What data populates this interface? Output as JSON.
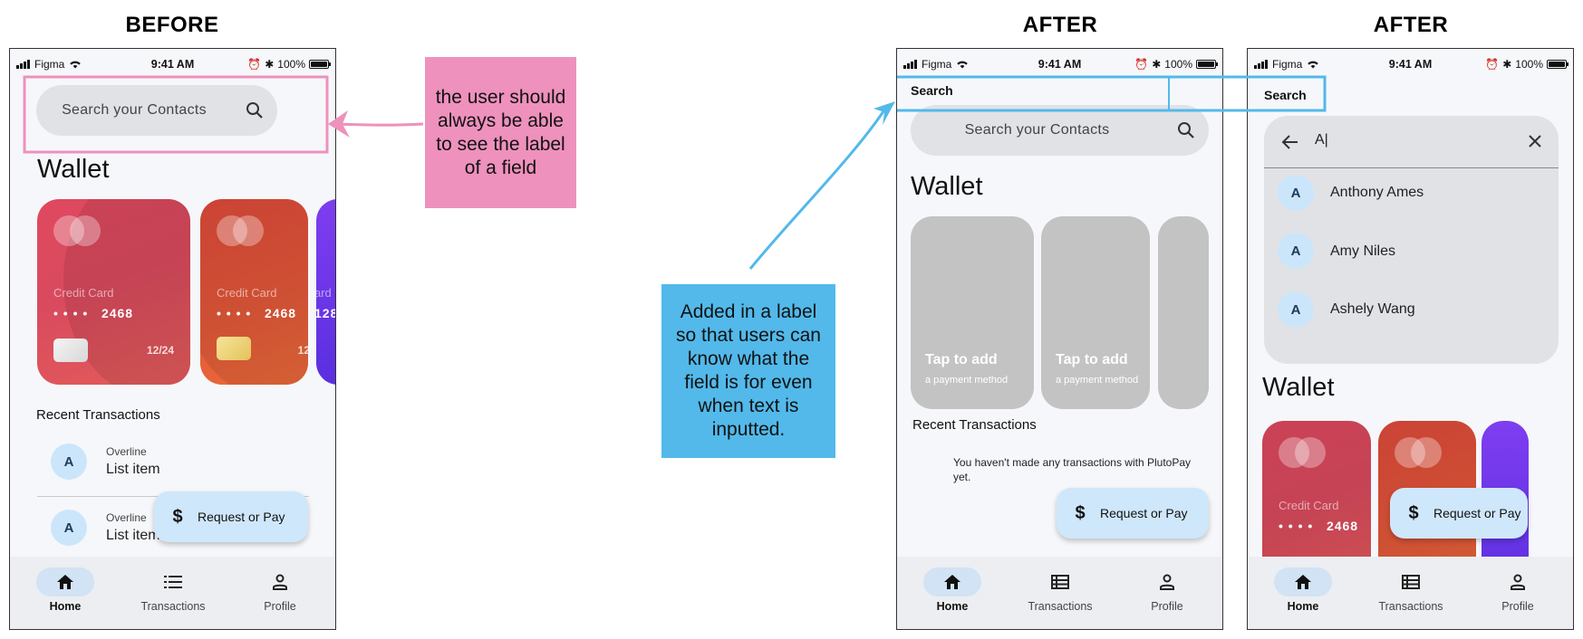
{
  "headings": {
    "before": "BEFORE",
    "after1": "AFTER",
    "after2": "AFTER"
  },
  "status": {
    "carrier": "Figma",
    "time": "9:41 AM",
    "battery": "100%"
  },
  "search": {
    "placeholder": "Search your Contacts",
    "label": "Search",
    "typed_value": "A|"
  },
  "wallet": {
    "title": "Wallet",
    "card_label": "Credit Card",
    "card_dots": "• • • •",
    "card_last4": "2468",
    "card_expiry": "12/24",
    "partial_label": "ard",
    "partial_number": "128",
    "partial_expiry": "12",
    "tap_main": "Tap to add",
    "tap_sub": "a payment method"
  },
  "transactions": {
    "title": "Recent Transactions",
    "empty": "You haven't made any transactions with PlutoPay yet.",
    "items": [
      {
        "avatar": "A",
        "overline": "Overline",
        "text": "List item"
      },
      {
        "avatar": "A",
        "overline": "Overline",
        "text": "List item"
      }
    ]
  },
  "contacts": [
    {
      "avatar": "A",
      "name": "Anthony Ames"
    },
    {
      "avatar": "A",
      "name": "Amy Niles"
    },
    {
      "avatar": "A",
      "name": "Ashely Wang"
    }
  ],
  "fab": {
    "label": "Request or Pay",
    "icon": "$"
  },
  "nav": {
    "home": "Home",
    "transactions": "Transactions",
    "profile": "Profile"
  },
  "notes": {
    "pink": "the user should always be able to see the label of a field",
    "blue": "Added in a label so that users can know what the field is for even when text is inputted."
  },
  "colors": {
    "pink_annotation": "#ee91bd",
    "blue_annotation": "#52b9ea",
    "fab_bg": "#cfe7fb",
    "avatar_bg": "#cbe6fb",
    "nav_active": "#d1e3f5"
  }
}
